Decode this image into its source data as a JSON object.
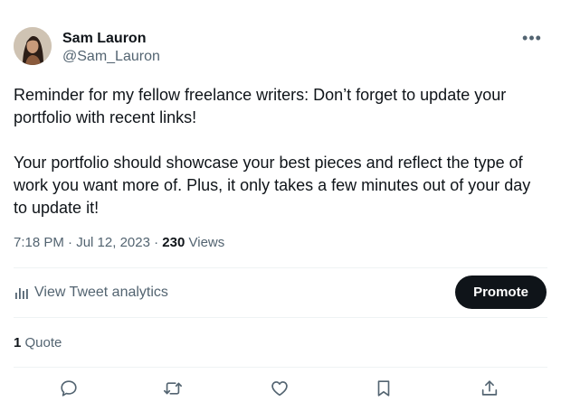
{
  "author": {
    "name": "Sam Lauron",
    "handle": "@Sam_Lauron"
  },
  "more_label": "•••",
  "tweet": {
    "text": "Reminder for my fellow freelance writers: Don’t forget to update your portfolio with recent links!\n\nYour portfolio should showcase your best pieces and reflect the type of work you want more of. Plus, it only takes a few minutes out of your day to update it!",
    "time": "7:18 PM",
    "date": "Jul 12, 2023",
    "views_count": "230",
    "views_label": "Views"
  },
  "analytics": {
    "label": "View Tweet analytics",
    "icon": "bar-chart-icon"
  },
  "promote_label": "Promote",
  "quotes": {
    "count": "1",
    "label": "Quote"
  },
  "actions": [
    {
      "name": "reply",
      "icon": "speech-bubble-icon"
    },
    {
      "name": "retweet",
      "icon": "retweet-arrows-icon"
    },
    {
      "name": "like",
      "icon": "heart-icon"
    },
    {
      "name": "bookmark",
      "icon": "bookmark-icon"
    },
    {
      "name": "share",
      "icon": "share-upload-icon"
    }
  ],
  "colors": {
    "text": "#0f1419",
    "secondary": "#536471",
    "divider": "#eff3f4",
    "button_bg": "#0f1419"
  }
}
